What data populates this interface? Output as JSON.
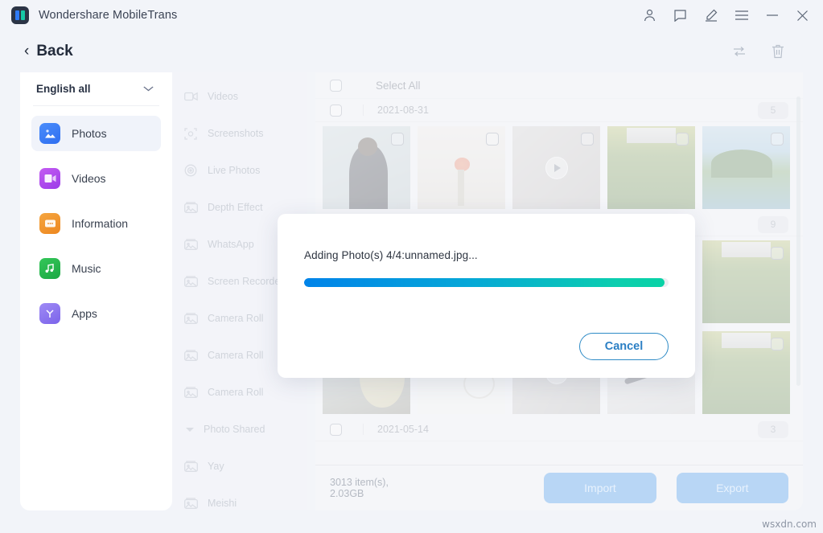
{
  "window": {
    "app_title": "Wondershare MobileTrans",
    "titlebar_icons": [
      {
        "name": "account-icon",
        "glyph": "person"
      },
      {
        "name": "feedback-icon",
        "glyph": "comment"
      },
      {
        "name": "edit-icon",
        "glyph": "pencil"
      },
      {
        "name": "menu-icon",
        "glyph": "hamburger"
      },
      {
        "name": "minimize-icon",
        "glyph": "minus"
      },
      {
        "name": "close-icon",
        "glyph": "x"
      }
    ]
  },
  "subheader": {
    "back_label": "Back",
    "back_chevron": "‹",
    "refresh_icon": "refresh-icon",
    "delete_icon": "trash-icon"
  },
  "sidebar": {
    "language": "English all",
    "caret": "⌄",
    "items": [
      {
        "label": "Photos",
        "icon": "photos-icon",
        "active": true
      },
      {
        "label": "Videos",
        "icon": "videos-icon",
        "active": false
      },
      {
        "label": "Information",
        "icon": "information-icon",
        "active": false
      },
      {
        "label": "Music",
        "icon": "music-icon",
        "active": false
      },
      {
        "label": "Apps",
        "icon": "apps-icon",
        "active": false
      }
    ]
  },
  "albums": {
    "items": [
      {
        "label": "Videos",
        "type": "item",
        "icon": "video-album-icon"
      },
      {
        "label": "Screenshots",
        "type": "item",
        "icon": "screenshot-album-icon"
      },
      {
        "label": "Live Photos",
        "type": "item",
        "icon": "live-photo-album-icon"
      },
      {
        "label": "Depth Effect",
        "type": "item",
        "icon": "photo-album-icon"
      },
      {
        "label": "WhatsApp",
        "type": "item",
        "icon": "photo-album-icon"
      },
      {
        "label": "Screen Recorder",
        "type": "item",
        "icon": "photo-album-icon"
      },
      {
        "label": "Camera Roll",
        "type": "item",
        "icon": "photo-album-icon"
      },
      {
        "label": "Camera Roll",
        "type": "item",
        "icon": "photo-album-icon"
      },
      {
        "label": "Camera Roll",
        "type": "item",
        "icon": "photo-album-icon"
      },
      {
        "label": "Photo Shared",
        "type": "group",
        "icon": "collapse-triangle-icon"
      },
      {
        "label": "Yay",
        "type": "item",
        "icon": "photo-album-icon"
      },
      {
        "label": "Meishi",
        "type": "item",
        "icon": "photo-album-icon"
      }
    ]
  },
  "content": {
    "select_all_label": "Select All",
    "groups": [
      {
        "date": "2021-08-31",
        "count": "5",
        "thumbs": [
          {
            "art": "t-person",
            "video": false
          },
          {
            "art": "t-flowers",
            "video": false
          },
          {
            "art": "t-video1",
            "video": true
          },
          {
            "art": "t-garden",
            "video": false
          },
          {
            "art": "t-palms",
            "video": false
          }
        ]
      },
      {
        "date": "",
        "count": "9",
        "thumbs": [
          {
            "art": "t-art",
            "video": false
          },
          {
            "art": "t-chart",
            "video": false
          },
          {
            "art": "t-video2",
            "video": true
          },
          {
            "art": "t-cable",
            "video": false
          },
          {
            "art": "t-garden",
            "video": false
          }
        ]
      },
      {
        "date": "",
        "count": "",
        "thumbs": [
          {
            "art": "t-art",
            "video": false
          },
          {
            "art": "t-chart",
            "video": false
          },
          {
            "art": "t-video2",
            "video": true
          },
          {
            "art": "t-cable",
            "video": false
          },
          {
            "art": "t-garden",
            "video": false
          }
        ]
      },
      {
        "date": "2021-05-14",
        "count": "3",
        "thumbs": []
      }
    ]
  },
  "bottom_bar": {
    "items_info": "3013 item(s), 2.03GB",
    "import_label": "Import",
    "export_label": "Export"
  },
  "modal": {
    "message": "Adding Photo(s) 4/4:unnamed.jpg...",
    "progress_percent": 99,
    "cancel_label": "Cancel"
  },
  "watermark": "wsxdn.com",
  "colors": {
    "accent_blue": "#2f6ef0",
    "progress_start": "#0083e9",
    "progress_end": "#09d2a6",
    "cancel_border": "#2e8bc6",
    "window_bg": "#f2f4f9",
    "panel_bg": "#f5f6f9"
  }
}
